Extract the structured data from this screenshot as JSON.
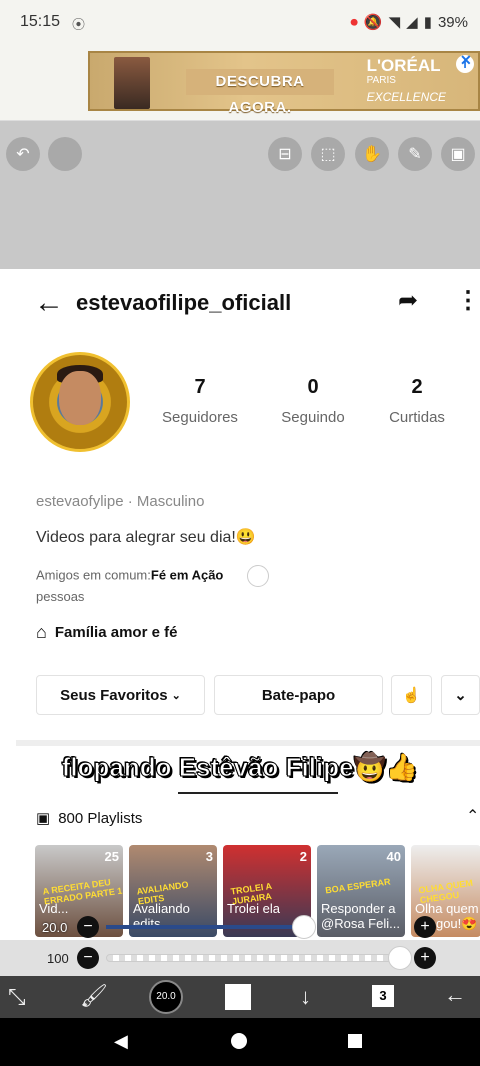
{
  "status": {
    "time": "15:15",
    "battery": "39%"
  },
  "ad": {
    "cta": "DESCUBRA AGORA.",
    "brand": "L'ORÉAL",
    "brand_sub": "PARIS",
    "product": "EXCELLENCE"
  },
  "profile": {
    "username": "estevaofilipe_oficiall",
    "followers": "7",
    "followers_label": "Seguidores",
    "following": "0",
    "following_label": "Seguindo",
    "likes": "2",
    "likes_label": "Curtidas",
    "handle": "estevaofylipe",
    "gender": "Masculino",
    "bio": "Videos para alegrar seu dia!😃",
    "friends_prefix": "Amigos em comum:",
    "friends_name": "Fé em Ação",
    "friends_suffix": "pessoas",
    "family": "Família amor e fé"
  },
  "buttons": {
    "favorites": "Seus Favoritos",
    "chat": "Bate-papo"
  },
  "caption": "flopando Estêvão Filipe🤠👍",
  "playlists": {
    "label": "800 Playlists",
    "items": [
      {
        "count": "25",
        "title": "Vid...",
        "tag": "A RECEITA DEU ERRADO PARTE 1"
      },
      {
        "count": "3",
        "title": "Avaliando edits",
        "tag": "AVALIANDO EDITS"
      },
      {
        "count": "2",
        "title": "Trolei ela",
        "tag": "TROLEI A JURAIRA"
      },
      {
        "count": "40",
        "title": "Responder a @Rosa Feli...",
        "tag": "BOA ESPERAR"
      },
      {
        "count": "",
        "title": "Olha quem chegou!😍",
        "tag": "OLHA QUEM CHEGOU"
      }
    ]
  },
  "editor": {
    "brush_size": "20.0",
    "size_slider": "20.0",
    "opacity_value": "100",
    "opacity": 1.0,
    "layers": "3"
  }
}
